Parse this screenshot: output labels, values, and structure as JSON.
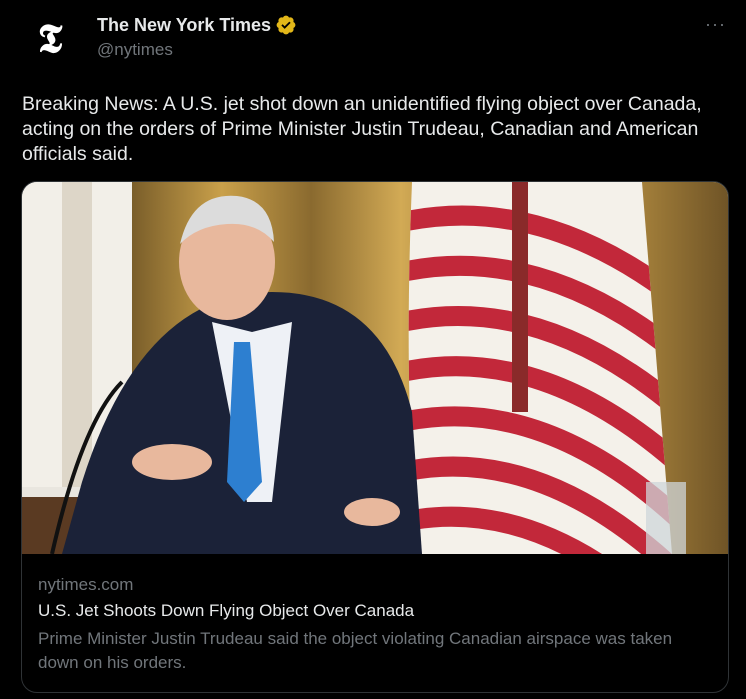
{
  "author": {
    "name": "The New York Times",
    "handle": "@nytimes",
    "avatar_glyph": "𝕿",
    "verified_color": "#e2b719"
  },
  "more_label": "···",
  "tweet_text": "Breaking News: A U.S. jet shot down an unidentified flying object over Canada, acting on the orders of Prime Minister Justin Trudeau, Canadian and American officials said.",
  "card": {
    "domain": "nytimes.com",
    "title": "U.S. Jet Shoots Down Flying Object Over Canada",
    "description": "Prime Minister Justin Trudeau said the object violating Canadian airspace was taken down on his orders."
  },
  "colors": {
    "background": "#000000",
    "text": "#e7e9ea",
    "muted": "#71767b",
    "border": "#2f3336"
  }
}
